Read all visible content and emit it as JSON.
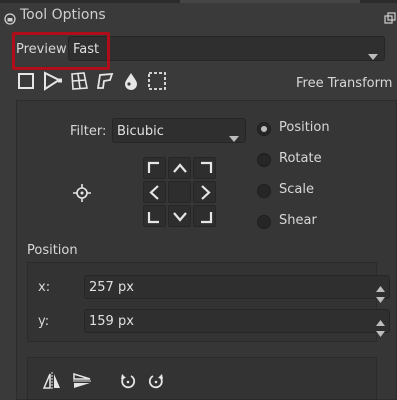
{
  "docker": {
    "title": "Tool Options",
    "icons": {
      "title": "tool-options-icon",
      "float": "float-window-icon"
    }
  },
  "preview": {
    "label": "Preview",
    "value": "Fast"
  },
  "transform_modes": {
    "active_label": "Free Transform",
    "icons": [
      "free-transform-icon",
      "perspective-icon",
      "warp-icon",
      "cage-icon",
      "liquify-icon",
      "mesh-icon"
    ]
  },
  "filter": {
    "label": "Filter:",
    "value": "Bicubic"
  },
  "anchor_grid": {
    "icons": [
      "top-left-icon",
      "top-icon",
      "top-right-icon",
      "left-icon",
      "center",
      "right-icon",
      "bottom-left-icon",
      "bottom-icon",
      "bottom-right-icon"
    ]
  },
  "mode_radios": [
    {
      "label": "Position",
      "checked": true
    },
    {
      "label": "Rotate",
      "checked": false
    },
    {
      "label": "Scale",
      "checked": false
    },
    {
      "label": "Shear",
      "checked": false
    }
  ],
  "position": {
    "label": "Position",
    "x_label": "x:",
    "x_value": "257 px",
    "y_label": "y:",
    "y_value": "159 px"
  },
  "bottom_tools": [
    "flip-horizontal-icon",
    "flip-vertical-icon",
    "rotate-ccw-icon",
    "rotate-cw-icon"
  ],
  "colors": {
    "background": "#3a3a3a",
    "field": "#2f2f2f",
    "highlight_box": "#b00d1a",
    "text": "#d8d8d8"
  }
}
